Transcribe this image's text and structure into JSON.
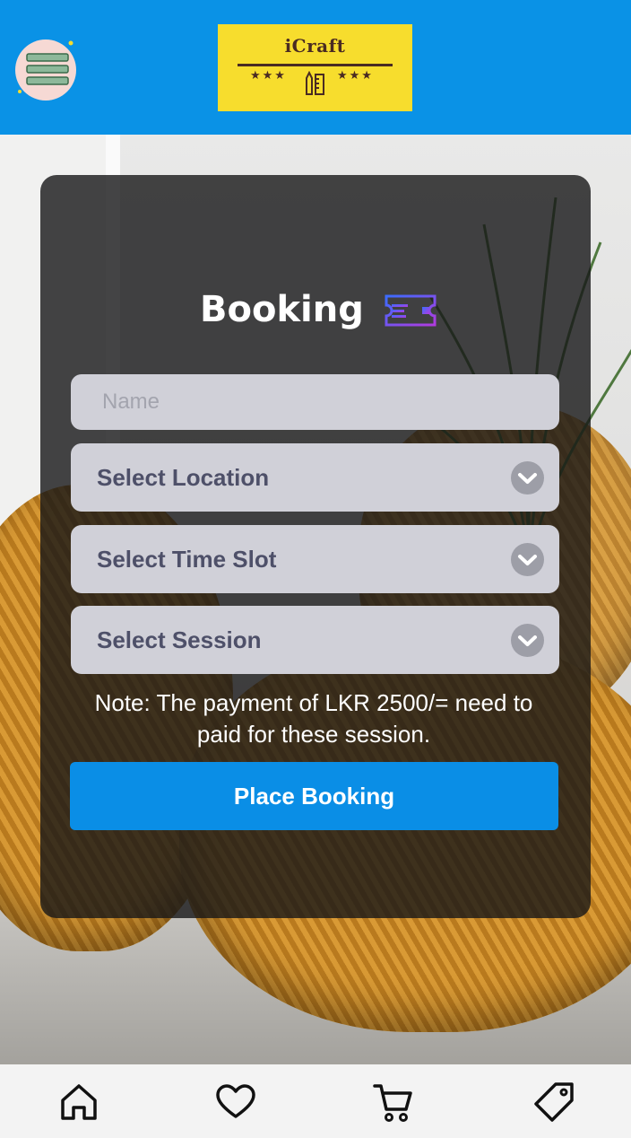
{
  "header": {
    "menu_icon": "hamburger-menu-icon",
    "logo": {
      "title": "iCraft",
      "stars_left": "★★★",
      "stars_right": "★★★",
      "icon": "pencil-ruler-icon"
    }
  },
  "booking": {
    "title": "Booking",
    "title_icon": "ticket-icon",
    "name_placeholder": "Name",
    "name_value": "",
    "selects": [
      {
        "label": "Select Location",
        "icon": "chevron-down-icon"
      },
      {
        "label": "Select Time Slot",
        "icon": "chevron-down-icon"
      },
      {
        "label": "Select Session",
        "icon": "chevron-down-icon"
      }
    ],
    "note": "Note: The payment of LKR 2500/= need to paid for these session.",
    "submit_label": "Place Booking"
  },
  "bottom_nav": [
    {
      "icon": "home-icon"
    },
    {
      "icon": "heart-icon"
    },
    {
      "icon": "cart-icon"
    },
    {
      "icon": "tag-icon"
    }
  ],
  "colors": {
    "header": "#0a92e6",
    "logo_bg": "#f7dd2d",
    "button": "#0a8ee6",
    "field_bg": "#d0d0d8",
    "card_bg": "#161618"
  }
}
